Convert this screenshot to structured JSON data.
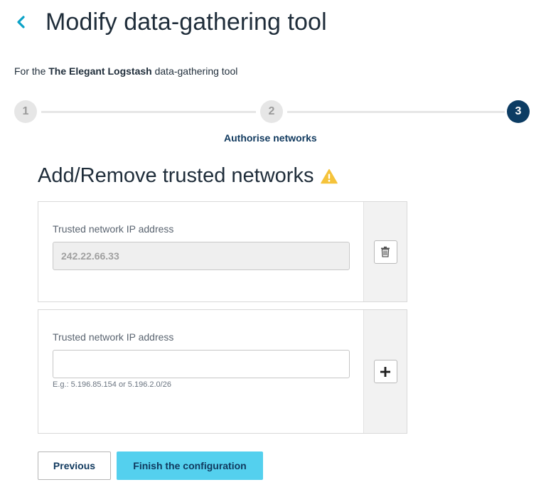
{
  "header": {
    "title": "Modify data-gathering tool",
    "back_icon": "chevron-left-icon",
    "accent_color": "#0aa2c7"
  },
  "subtitle": {
    "prefix": "For the",
    "tool_name": "The Elegant Logstash",
    "suffix": "data-gathering tool"
  },
  "stepper": {
    "steps": [
      {
        "number": "1",
        "state": "done"
      },
      {
        "number": "2",
        "state": "done"
      },
      {
        "number": "3",
        "state": "active"
      }
    ],
    "active_label": "Authorise networks",
    "active_color": "#0c3c63"
  },
  "section": {
    "title": "Add/Remove trusted networks",
    "warning_icon": "warning-triangle-icon",
    "warning_color": "#f5c33b"
  },
  "networks": [
    {
      "label": "Trusted network IP address",
      "value": "242.22.66.33",
      "disabled": true,
      "action_icon": "trash-icon"
    },
    {
      "label": "Trusted network IP address",
      "value": "",
      "placeholder": "",
      "hint": "E.g.: 5.196.85.154 or 5.196.2.0/26",
      "action_icon": "plus-icon"
    }
  ],
  "actions": {
    "previous_label": "Previous",
    "finish_label": "Finish the configuration",
    "finish_color": "#54d0ee"
  }
}
